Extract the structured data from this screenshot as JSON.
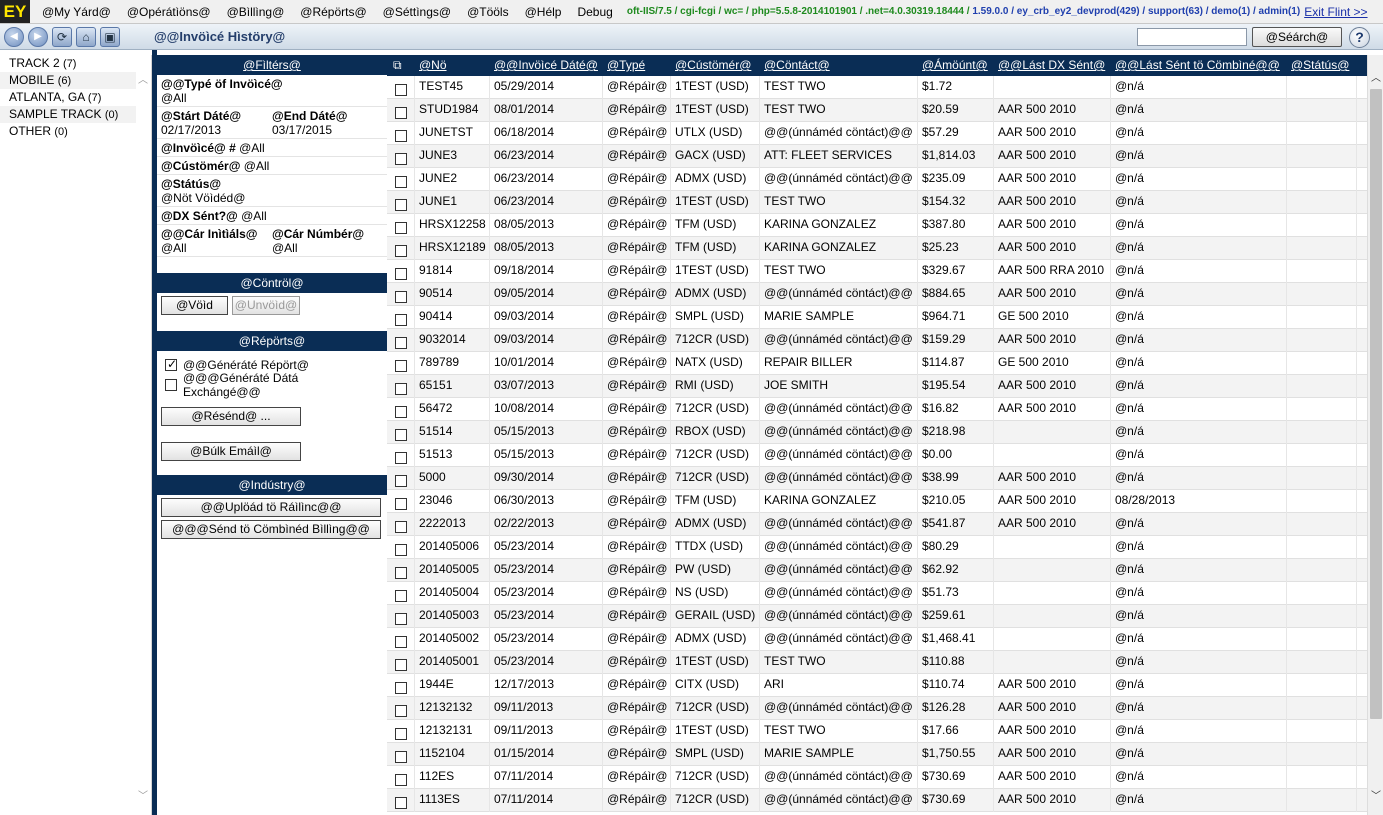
{
  "app": {
    "logo": "EY"
  },
  "menu": [
    "@My Yárd@",
    "@Opérátìöns@",
    "@Bìllìng@",
    "@Répörts@",
    "@Séttìngs@",
    "@Tööls",
    "@Hélp",
    "Debug"
  ],
  "sysinfo": {
    "green": "oft-IIS/7.5 / cgi-fcgi / wc= / php=5.5.8-2014101901 / .net=4.0.30319.18444 /",
    "blue": "1.59.0.0 / ey_crb_ey2_devprod(429) / support(63) / demo(1) / admin(1)",
    "exit": "Exit Flint >>"
  },
  "titlebar": {
    "title": "@@Invöìcé Hìstöry@",
    "search_placeholder": "",
    "search_label": "@Séárch@",
    "help_label": "?",
    "icons": [
      "back-icon",
      "forward-icon",
      "refresh-icon",
      "home-icon",
      "window-icon"
    ]
  },
  "tracks": [
    {
      "name": "TRACK 2",
      "count": "(7)"
    },
    {
      "name": "MOBILE",
      "count": "(6)"
    },
    {
      "name": "ATLANTA, GA",
      "count": "(7)"
    },
    {
      "name": "SAMPLE TRACK",
      "count": "(0)"
    },
    {
      "name": "OTHER",
      "count": "(0)"
    }
  ],
  "filters": {
    "header": "@Fìltérs@",
    "type_label": "@@Typé öf Invöìcé@",
    "type_value": "@All",
    "start_label": "@Stárt Dáté@",
    "start_value": "02/17/2013",
    "end_label": "@End Dáté@",
    "end_value": "03/17/2015",
    "invoice_label": "@Invöìcé@ #",
    "invoice_value": "@All",
    "customer_label": "@Cústömér@",
    "customer_value": "@All",
    "status_label": "@Státús@",
    "status_value": "@Nöt Vöìdéd@",
    "dx_label": "@DX Sént?@",
    "dx_value": "@All",
    "car_initials_label": "@@Cár Inìtìáls@",
    "car_initials_value": "@All",
    "car_number_label": "@Cár Númbér@",
    "car_number_value": "@All"
  },
  "control": {
    "header": "@Cöntröl@",
    "void_label": "@Vöìd",
    "unvoid_label": "@Unvöìd@"
  },
  "reports": {
    "header": "@Répörts@",
    "generate_report": "@@Généráté Répört@",
    "generate_report_checked": true,
    "generate_data_exchange": "@@@Généráté Dátá Exchángé@@",
    "generate_data_exchange_checked": false,
    "resend_label": "@Résénd@ ...",
    "bulk_email_label": "@Búlk Emáìl@"
  },
  "industry": {
    "header": "@Indústry@",
    "upload_label": "@@Uplöád tö Ráìlìnc@@",
    "send_combined_label": "@@@Sénd tö Cömbìnéd Bìllìng@@"
  },
  "grid": {
    "columns": [
      "@Nö",
      "@@Invöìcé Dáté@",
      "@Typé",
      "@Cústömér@",
      "@Cöntáct@",
      "@Ámöúnt@",
      "@@Lást DX Sént@",
      "@@Lást Sént tö Cömbìné@@",
      "@Státús@"
    ],
    "rows": [
      [
        "TEST45",
        "05/29/2014",
        "@Répáìr@",
        "1TEST (USD)",
        "TEST TWO",
        "$1.72",
        "",
        "@n/á",
        ""
      ],
      [
        "STUD1984",
        "08/01/2014",
        "@Répáìr@",
        "1TEST (USD)",
        "TEST TWO",
        "$20.59",
        "AAR 500 2010",
        "@n/á",
        ""
      ],
      [
        "JUNETST",
        "06/18/2014",
        "@Répáìr@",
        "UTLX (USD)",
        "@@(únnáméd cöntáct)@@",
        "$57.29",
        "AAR 500 2010",
        "@n/á",
        ""
      ],
      [
        "JUNE3",
        "06/23/2014",
        "@Répáìr@",
        "GACX (USD)",
        "ATT: FLEET SERVICES",
        "$1,814.03",
        "AAR 500 2010",
        "@n/á",
        ""
      ],
      [
        "JUNE2",
        "06/23/2014",
        "@Répáìr@",
        "ADMX (USD)",
        "@@(únnáméd cöntáct)@@",
        "$235.09",
        "AAR 500 2010",
        "@n/á",
        ""
      ],
      [
        "JUNE1",
        "06/23/2014",
        "@Répáìr@",
        "1TEST (USD)",
        "TEST TWO",
        "$154.32",
        "AAR 500 2010",
        "@n/á",
        ""
      ],
      [
        "HRSX12258",
        "08/05/2013",
        "@Répáìr@",
        "TFM (USD)",
        "KARINA GONZALEZ",
        "$387.80",
        "AAR 500 2010",
        "@n/á",
        ""
      ],
      [
        "HRSX12189",
        "08/05/2013",
        "@Répáìr@",
        "TFM (USD)",
        "KARINA GONZALEZ",
        "$25.23",
        "AAR 500 2010",
        "@n/á",
        ""
      ],
      [
        "91814",
        "09/18/2014",
        "@Répáìr@",
        "1TEST (USD)",
        "TEST TWO",
        "$329.67",
        "AAR 500 RRA 2010",
        "@n/á",
        ""
      ],
      [
        "90514",
        "09/05/2014",
        "@Répáìr@",
        "ADMX (USD)",
        "@@(únnáméd cöntáct)@@",
        "$884.65",
        "AAR 500 2010",
        "@n/á",
        ""
      ],
      [
        "90414",
        "09/03/2014",
        "@Répáìr@",
        "SMPL (USD)",
        "MARIE SAMPLE",
        "$964.71",
        "GE 500 2010",
        "@n/á",
        ""
      ],
      [
        "9032014",
        "09/03/2014",
        "@Répáìr@",
        "712CR (USD)",
        "@@(únnáméd cöntáct)@@",
        "$159.29",
        "AAR 500 2010",
        "@n/á",
        ""
      ],
      [
        "789789",
        "10/01/2014",
        "@Répáìr@",
        "NATX (USD)",
        "REPAIR BILLER",
        "$114.87",
        "GE 500 2010",
        "@n/á",
        ""
      ],
      [
        "65151",
        "03/07/2013",
        "@Répáìr@",
        "RMI (USD)",
        "JOE SMITH",
        "$195.54",
        "AAR 500 2010",
        "@n/á",
        ""
      ],
      [
        "56472",
        "10/08/2014",
        "@Répáìr@",
        "712CR (USD)",
        "@@(únnáméd cöntáct)@@",
        "$16.82",
        "AAR 500 2010",
        "@n/á",
        ""
      ],
      [
        "51514",
        "05/15/2013",
        "@Répáìr@",
        "RBOX (USD)",
        "@@(únnáméd cöntáct)@@",
        "$218.98",
        "",
        "@n/á",
        ""
      ],
      [
        "51513",
        "05/15/2013",
        "@Répáìr@",
        "712CR (USD)",
        "@@(únnáméd cöntáct)@@",
        "$0.00",
        "",
        "@n/á",
        ""
      ],
      [
        "5000",
        "09/30/2014",
        "@Répáìr@",
        "712CR (USD)",
        "@@(únnáméd cöntáct)@@",
        "$38.99",
        "AAR 500 2010",
        "@n/á",
        ""
      ],
      [
        "23046",
        "06/30/2013",
        "@Répáìr@",
        "TFM (USD)",
        "KARINA GONZALEZ",
        "$210.05",
        "AAR 500 2010",
        "08/28/2013",
        ""
      ],
      [
        "2222013",
        "02/22/2013",
        "@Répáìr@",
        "ADMX (USD)",
        "@@(únnáméd cöntáct)@@",
        "$541.87",
        "AAR 500 2010",
        "@n/á",
        ""
      ],
      [
        "201405006",
        "05/23/2014",
        "@Répáìr@",
        "TTDX (USD)",
        "@@(únnáméd cöntáct)@@",
        "$80.29",
        "",
        "@n/á",
        ""
      ],
      [
        "201405005",
        "05/23/2014",
        "@Répáìr@",
        "PW (USD)",
        "@@(únnáméd cöntáct)@@",
        "$62.92",
        "",
        "@n/á",
        ""
      ],
      [
        "201405004",
        "05/23/2014",
        "@Répáìr@",
        "NS (USD)",
        "@@(únnáméd cöntáct)@@",
        "$51.73",
        "",
        "@n/á",
        ""
      ],
      [
        "201405003",
        "05/23/2014",
        "@Répáìr@",
        "GERAIL (USD)",
        "@@(únnáméd cöntáct)@@",
        "$259.61",
        "",
        "@n/á",
        ""
      ],
      [
        "201405002",
        "05/23/2014",
        "@Répáìr@",
        "ADMX (USD)",
        "@@(únnáméd cöntáct)@@",
        "$1,468.41",
        "",
        "@n/á",
        ""
      ],
      [
        "201405001",
        "05/23/2014",
        "@Répáìr@",
        "1TEST (USD)",
        "TEST TWO",
        "$110.88",
        "",
        "@n/á",
        ""
      ],
      [
        "1944E",
        "12/17/2013",
        "@Répáìr@",
        "CITX (USD)",
        "ARI",
        "$110.74",
        "AAR 500 2010",
        "@n/á",
        ""
      ],
      [
        "12132132",
        "09/11/2013",
        "@Répáìr@",
        "712CR (USD)",
        "@@(únnáméd cöntáct)@@",
        "$126.28",
        "AAR 500 2010",
        "@n/á",
        ""
      ],
      [
        "12132131",
        "09/11/2013",
        "@Répáìr@",
        "1TEST (USD)",
        "TEST TWO",
        "$17.66",
        "AAR 500 2010",
        "@n/á",
        ""
      ],
      [
        "1152104",
        "01/15/2014",
        "@Répáìr@",
        "SMPL (USD)",
        "MARIE SAMPLE",
        "$1,750.55",
        "AAR 500 2010",
        "@n/á",
        ""
      ],
      [
        "112ES",
        "07/11/2014",
        "@Répáìr@",
        "712CR (USD)",
        "@@(únnáméd cöntáct)@@",
        "$730.69",
        "AAR 500 2010",
        "@n/á",
        ""
      ],
      [
        "1113ES",
        "07/11/2014",
        "@Répáìr@",
        "712CR (USD)",
        "@@(únnáméd cöntáct)@@",
        "$730.69",
        "AAR 500 2010",
        "@n/á",
        ""
      ]
    ]
  },
  "colors": {
    "panel_header": "#0a2d55",
    "title_text": "#243e6b",
    "sysinfo_green": "#1e8a1e",
    "sysinfo_blue": "#1f3fae",
    "logo_bg": "#222222",
    "logo_fg": "#ffe600"
  }
}
